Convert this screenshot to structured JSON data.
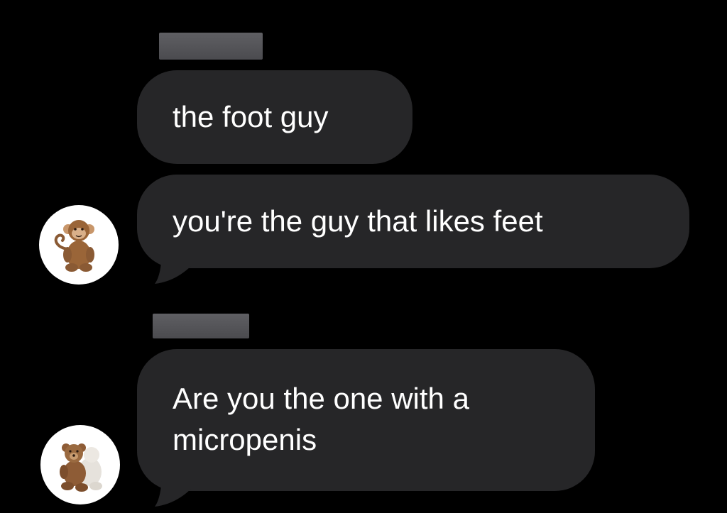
{
  "chat": {
    "messages": [
      {
        "text": "the foot guy"
      },
      {
        "text": "you're the guy that likes feet"
      },
      {
        "text": "Are you the one with a\nmicropenis"
      }
    ],
    "avatars": [
      {
        "icon": "monkey-plush-icon"
      },
      {
        "icon": "teddy-bear-plush-icon"
      }
    ]
  },
  "colors": {
    "background": "#000000",
    "bubble": "#262628",
    "text": "#ffffff",
    "redaction": "#55555a"
  }
}
